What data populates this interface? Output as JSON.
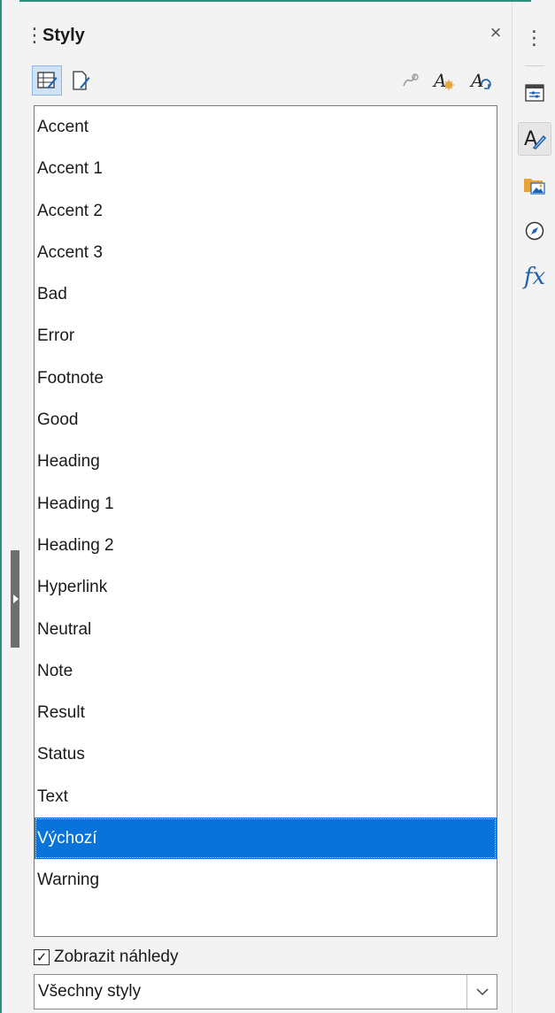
{
  "deck": {
    "title": "Styly",
    "close_glyph": "×",
    "grip_glyph": "⋮"
  },
  "toolbar": {
    "buttons": [
      {
        "name": "cell-styles-icon",
        "active": true
      },
      {
        "name": "page-styles-icon",
        "active": false
      },
      {
        "name": "fill-format-mode-icon",
        "active": false
      },
      {
        "name": "new-style-from-selection-icon",
        "active": false
      },
      {
        "name": "update-style-icon",
        "active": false
      }
    ]
  },
  "styles": {
    "items": [
      "Accent",
      "Accent 1",
      "Accent 2",
      "Accent 3",
      "Bad",
      "Error",
      "Footnote",
      "Good",
      "Heading",
      "Heading 1",
      "Heading 2",
      "Hyperlink",
      "Neutral",
      "Note",
      "Result",
      "Status",
      "Text",
      "Výchozí",
      "Warning"
    ],
    "selected": "Výchozí"
  },
  "preview": {
    "label": "Zobrazit náhledy",
    "checked": true,
    "check_glyph": "✓"
  },
  "filter": {
    "value": "Všechny styly"
  },
  "tabbar": {
    "menu_glyph": "⋮",
    "tabs": [
      {
        "name": "properties-icon",
        "active": false
      },
      {
        "name": "styles-icon",
        "active": true
      },
      {
        "name": "gallery-icon",
        "active": false
      },
      {
        "name": "navigator-icon",
        "active": false
      },
      {
        "name": "functions-icon",
        "active": false
      }
    ],
    "functions_glyph": "fx"
  },
  "colors": {
    "accent_border": "#2f8f7f",
    "selection": "#0a73d9",
    "icon_blue": "#1e63b5",
    "icon_orange": "#e8a33a"
  }
}
